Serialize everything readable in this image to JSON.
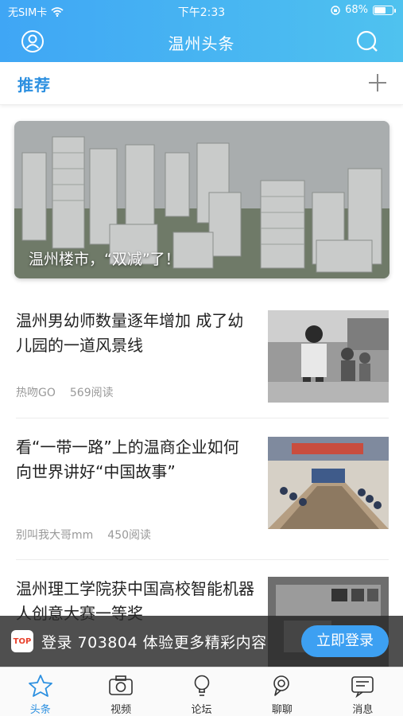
{
  "status_bar": {
    "carrier": "无SIM卡",
    "time": "下午2:33",
    "battery_percent": "68%",
    "battery_level": 0.68
  },
  "header": {
    "title": "温州头条",
    "user_icon": "user-icon",
    "search_icon": "search-icon",
    "gradient_start": "#3fa6f5",
    "gradient_end": "#4fc2ef"
  },
  "channels": {
    "active_tab": "推荐",
    "add_icon": "plus-icon"
  },
  "banner": {
    "caption": "温州楼市，“双减”了！"
  },
  "articles": [
    {
      "title": "温州男幼师数量逐年增加 成了幼儿园的一道风景线",
      "source": "热吻GO",
      "reads": "569阅读"
    },
    {
      "title": "看“一带一路”上的温商企业如何向世界讲好“中国故事”",
      "source": "别叫我大哥mm",
      "reads": "450阅读"
    },
    {
      "title": "温州理工学院获中国高校智能机器人创意大赛一等奖",
      "source": "",
      "reads": ""
    }
  ],
  "login_prompt": {
    "message": "登录 703804 体验更多精彩内容",
    "button": "立即登录",
    "app_icon_text": "TOP",
    "accent": "#3da0f2"
  },
  "tabbar": {
    "items": [
      {
        "label": "头条",
        "icon": "star-icon",
        "active": true
      },
      {
        "label": "视频",
        "icon": "camera-icon",
        "active": false
      },
      {
        "label": "论坛",
        "icon": "lightbulb-icon",
        "active": false
      },
      {
        "label": "聊聊",
        "icon": "chat-bubble-icon",
        "active": false
      },
      {
        "label": "消息",
        "icon": "message-icon",
        "active": false
      }
    ],
    "active_color": "#2b8fe0"
  }
}
